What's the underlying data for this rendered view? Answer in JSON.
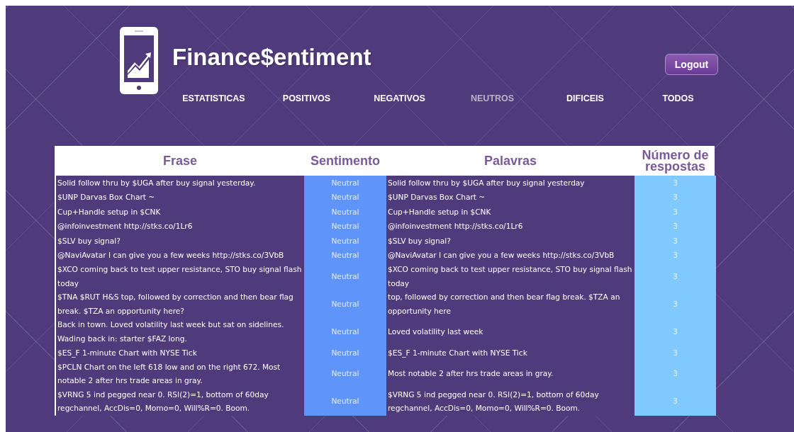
{
  "header": {
    "title": "Finance$entiment",
    "logout": "Logout"
  },
  "nav": [
    {
      "label": "ESTATISTICAS",
      "selected": false
    },
    {
      "label": "POSITIVOS",
      "selected": false
    },
    {
      "label": "NEGATIVOS",
      "selected": false
    },
    {
      "label": "NEUTROS",
      "selected": true
    },
    {
      "label": "DIFICEIS",
      "selected": false
    },
    {
      "label": "TODOS",
      "selected": false
    }
  ],
  "table": {
    "columns": [
      "Frase",
      "Sentimento",
      "Palavras",
      "Número de respostas"
    ],
    "rows": [
      {
        "frase": "Solid follow thru by $UGA after buy signal yesterday.",
        "sentimento": "Neutral",
        "palavras": "Solid follow thru by $UGA after buy signal yesterday",
        "respostas": "3"
      },
      {
        "frase": "$UNP Darvas Box Chart ~",
        "sentimento": "Neutral",
        "palavras": "$UNP Darvas Box Chart ~",
        "respostas": "3"
      },
      {
        "frase": "Cup+Handle setup in $CNK",
        "sentimento": "Neutral",
        "palavras": "Cup+Handle setup in $CNK",
        "respostas": "3"
      },
      {
        "frase": "@infoinvestment http://stks.co/1Lr6",
        "sentimento": "Neutral",
        "palavras": "@infoinvestment http://stks.co/1Lr6",
        "respostas": "3"
      },
      {
        "frase": "$SLV buy signal?",
        "sentimento": "Neutral",
        "palavras": "$SLV buy signal?",
        "respostas": "3"
      },
      {
        "frase": "@NaviAvatar I can give you a few weeks http://stks.co/3VbB",
        "sentimento": "Neutral",
        "palavras": "@NaviAvatar I can give you a few weeks http://stks.co/3VbB",
        "respostas": "3"
      },
      {
        "frase": "$XCO coming back to test upper resistance, STO buy signal flash today",
        "sentimento": "Neutral",
        "palavras": "$XCO coming back to test upper resistance, STO buy signal flash today",
        "respostas": "3"
      },
      {
        "frase": "$TNA $RUT H&S top, followed by correction and then bear flag break. $TZA an opportunity here?",
        "sentimento": "Neutral",
        "palavras": "top, followed by correction and then bear flag break. $TZA an opportunity here",
        "respostas": "3"
      },
      {
        "frase": "Back in town. Loved volatility last week but sat on sidelines. Wading back in: starter $FAZ long.",
        "sentimento": "Neutral",
        "palavras": "Loved volatility last week",
        "respostas": "3"
      },
      {
        "frase": "$ES_F 1-minute Chart with NYSE Tick",
        "sentimento": "Neutral",
        "palavras": "$ES_F 1-minute Chart with NYSE Tick",
        "respostas": "3"
      },
      {
        "frase": "$PCLN Chart on the left 618 low and on the right 672. Most notable 2 after hrs trade areas in gray.",
        "sentimento": "Neutral",
        "palavras": "Most notable 2 after hrs trade areas in gray.",
        "respostas": "3"
      },
      {
        "frase": "$VRNG 5 ind pegged near 0. RSI(2)=1, bottom of 60day regchannel, AccDis=0, Momo=0, Will%R=0. Boom.",
        "sentimento": "Neutral",
        "palavras": "$VRNG 5 ind pegged near 0. RSI(2)=1, bottom of 60day regchannel, AccDis=0, Momo=0, Will%R=0. Boom.",
        "respostas": "3"
      }
    ]
  }
}
